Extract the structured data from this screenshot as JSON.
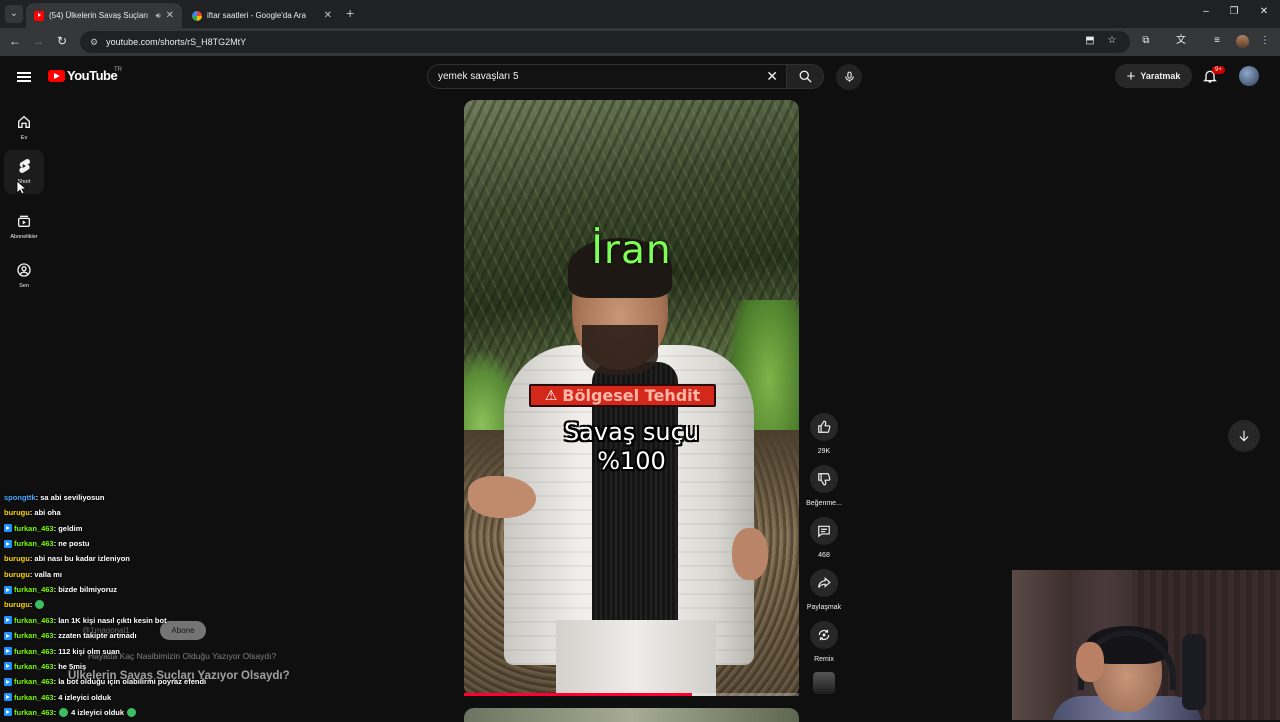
{
  "browser": {
    "tabs": [
      {
        "title": "(54) Ülkelerin Savaş Suçları",
        "active": true,
        "playing_audio": true
      },
      {
        "title": "iftar saatleri - Google'da Ara",
        "active": false
      }
    ],
    "url": "youtube.com/shorts/rS_H8TG2MtY"
  },
  "youtube": {
    "logo_text": "YouTube",
    "country_code": "TR",
    "search": {
      "query": "yemek savaşları 5"
    },
    "create_label": "Yaratmak",
    "notification_count": "9+",
    "guide": [
      {
        "label": "Ev",
        "icon": "home-icon"
      },
      {
        "label": "Short",
        "icon": "shorts-icon",
        "active": true
      },
      {
        "label": "Abonelikler",
        "icon": "subscriptions-icon"
      },
      {
        "label": "Sen",
        "icon": "you-icon"
      }
    ]
  },
  "short": {
    "overlay_title": "İran",
    "badge_text": "Bölgesel Tehdit",
    "caption_line1": "Savaş suçu",
    "caption_line2": "%100",
    "progress": 0.68,
    "actions": {
      "like_count": "29K",
      "dislike_label": "Beğenme...",
      "comment_count": "468",
      "share_label": "Paylaşmak",
      "remix_label": "Remix"
    }
  },
  "stream_overlay": {
    "chat": [
      {
        "user": "spongttk",
        "color": "#4aa8ff",
        "badge": false,
        "msg": " : sa abi seviliyosun"
      },
      {
        "user": "burugu",
        "color": "#ffd700",
        "badge": false,
        "msg": " : abi oha"
      },
      {
        "user": "furkan_463",
        "color": "#7cfc00",
        "badge": true,
        "msg": " : geldim"
      },
      {
        "user": "furkan_463",
        "color": "#7cfc00",
        "badge": true,
        "msg": " : ne postu"
      },
      {
        "user": "burugu",
        "color": "#ffd700",
        "badge": false,
        "msg": " : abi nası bu kadar izleniyon"
      },
      {
        "user": "burugu",
        "color": "#ffd700",
        "badge": false,
        "msg": " : valla mı"
      },
      {
        "user": "furkan_463",
        "color": "#7cfc00",
        "badge": true,
        "msg": " : bizde bilmiyoruz"
      },
      {
        "user": "burugu",
        "color": "#ffd700",
        "badge": false,
        "msg": " : ",
        "emote": true
      },
      {
        "user": "furkan_463",
        "color": "#7cfc00",
        "badge": true,
        "msg": " : lan 1K kişi nasıl çıktı kesin bot"
      },
      {
        "user": "furkan_463",
        "color": "#7cfc00",
        "badge": true,
        "msg": " : zzaten takipte artmadı"
      },
      {
        "user": "furkan_463",
        "color": "#7cfc00",
        "badge": true,
        "msg": " : 112 kişi olm suan"
      },
      {
        "user": "furkan_463",
        "color": "#7cfc00",
        "badge": true,
        "msg": " : he 5miş"
      },
      {
        "user": "furkan_463",
        "color": "#7cfc00",
        "badge": true,
        "msg": " : la bot olduğu için olabilirmi poyraz efendi"
      },
      {
        "user": "furkan_463",
        "color": "#7cfc00",
        "badge": true,
        "msg": " : 4 izleyici olduk"
      },
      {
        "user": "furkan_463",
        "color": "#7cfc00",
        "badge": true,
        "msg": " : ",
        "emote": true,
        "msg2": "4 izleyici olduk"
      }
    ],
    "ghost_subscribe_label": "Abone",
    "ghost_handle": "@1magonal1",
    "ghost_sub_text": "Hayatta Kaç Nasibimizin Olduğu Yazıyor Olsaydı?",
    "ghost_title": "Ülkelerin Savaş Suçları Yazıyor Olsaydı?"
  },
  "colors": {
    "youtube_red": "#ff0000",
    "overlay_green": "#7dff58",
    "badge_red": "#d4281b",
    "progress_red": "#ff0033"
  }
}
